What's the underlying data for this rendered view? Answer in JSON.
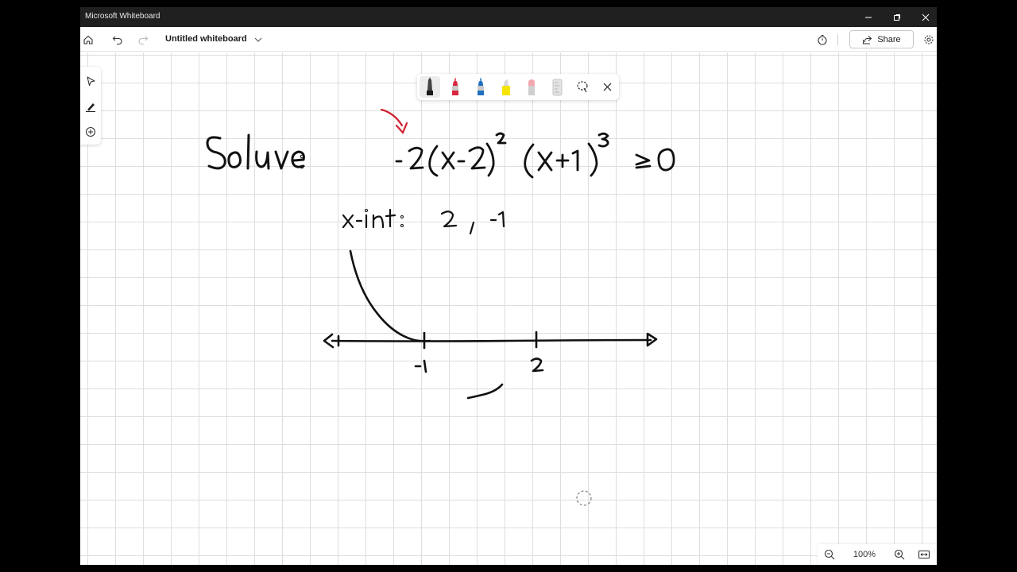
{
  "window": {
    "app_title": "Microsoft Whiteboard"
  },
  "commandbar": {
    "board_title": "Untitled whiteboard",
    "share_label": "Share"
  },
  "left_toolbar": {
    "tools": [
      "select-icon",
      "inking-icon",
      "add-icon"
    ]
  },
  "ink_toolbar": {
    "tools": [
      {
        "name": "black-pen",
        "color": "#1a1a1a",
        "selected": true
      },
      {
        "name": "red-pen",
        "color": "#d7263d"
      },
      {
        "name": "blue-pen",
        "color": "#1e6fbf"
      },
      {
        "name": "yellow-highlighter",
        "color": "#f5e400"
      },
      {
        "name": "eraser",
        "color": "#f2a7b0"
      },
      {
        "name": "ruler",
        "color": "#d0d0d0"
      },
      {
        "name": "lasso-select",
        "color": "#333333"
      }
    ]
  },
  "board_ink": {
    "problem_label": "Solve:",
    "inequality": "-2(x-2)²(x+1)³ ≥ 0",
    "x_intercepts_text": "x-int: 2, -1",
    "number_line_ticks": [
      "-1",
      "2"
    ],
    "ink_colors": {
      "black": "#111111",
      "red": "#d0202e"
    }
  },
  "zoom": {
    "level": "100%"
  }
}
